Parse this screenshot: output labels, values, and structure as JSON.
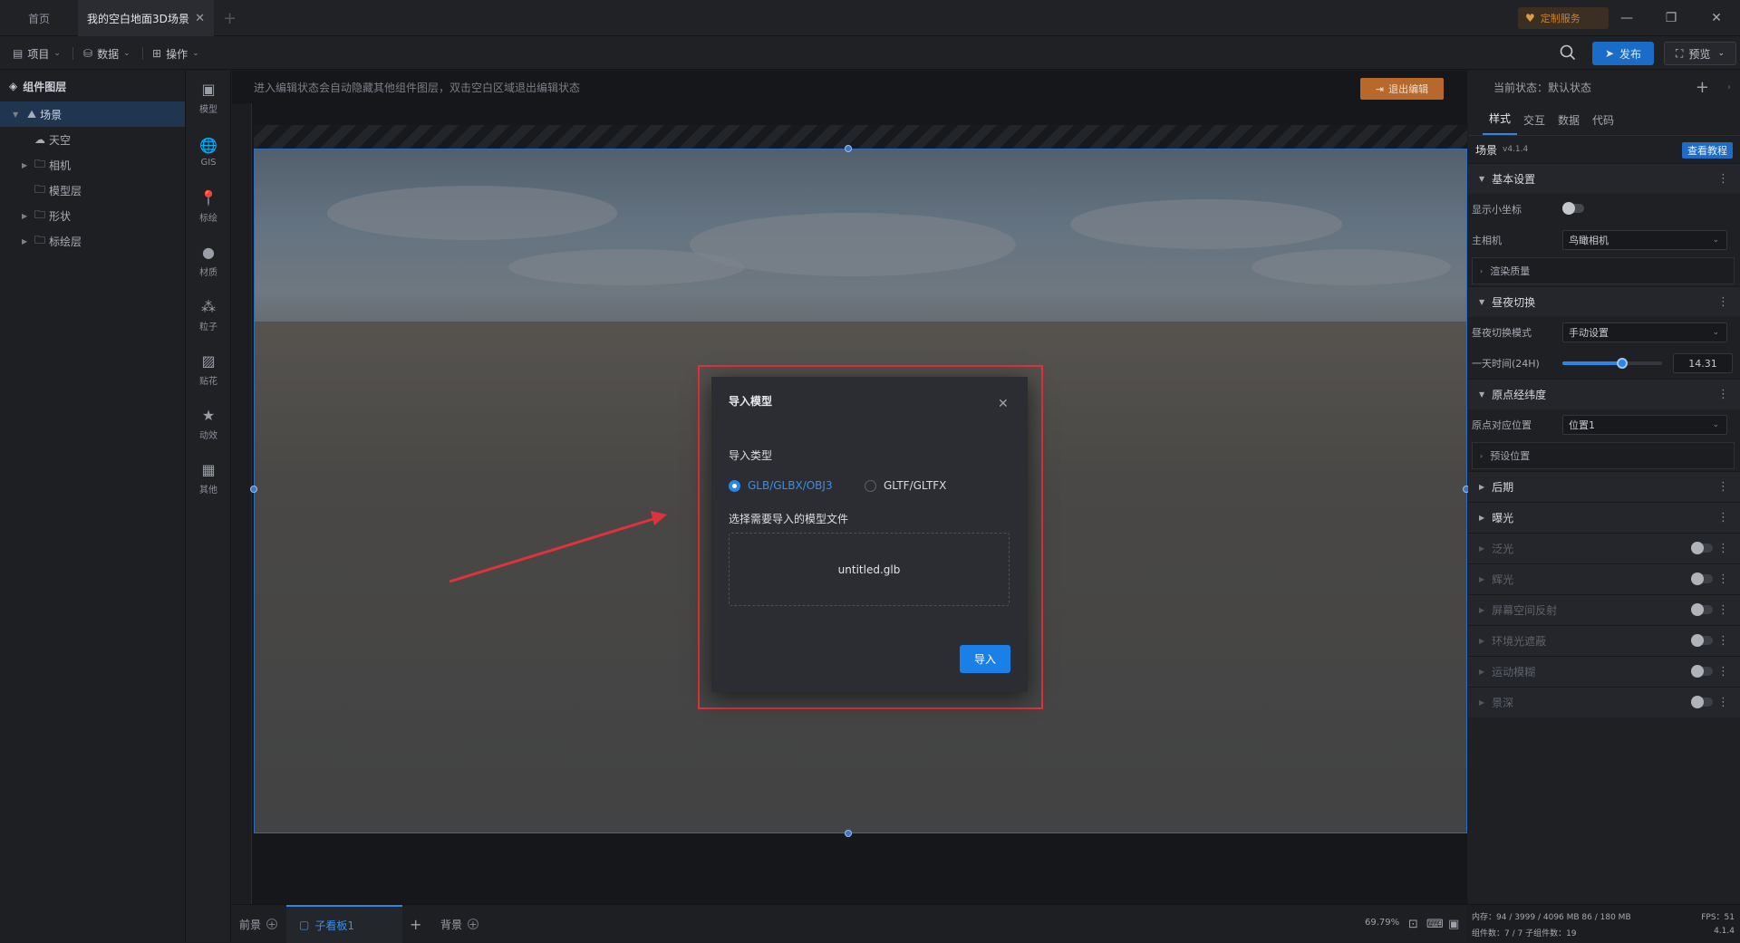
{
  "titlebar": {
    "tabs": [
      {
        "label": "首页"
      },
      {
        "label": "我的空白地面3D场景"
      }
    ],
    "custom_service": "定制服务"
  },
  "menubar": {
    "items": [
      {
        "label": "项目"
      },
      {
        "label": "数据"
      },
      {
        "label": "操作"
      }
    ],
    "publish": "发布",
    "preview": "预览"
  },
  "layers": {
    "title": "组件图层",
    "items": [
      {
        "label": "场景"
      },
      {
        "label": "天空"
      },
      {
        "label": "相机"
      },
      {
        "label": "模型层"
      },
      {
        "label": "形状"
      },
      {
        "label": "标绘层"
      }
    ]
  },
  "toolbar": {
    "items": [
      {
        "label": "模型",
        "icon": "cube-icon"
      },
      {
        "label": "GIS",
        "icon": "globe-icon"
      },
      {
        "label": "标绘",
        "icon": "pin-icon"
      },
      {
        "label": "材质",
        "icon": "sphere-icon"
      },
      {
        "label": "粒子",
        "icon": "particle-icon"
      },
      {
        "label": "贴花",
        "icon": "image-icon"
      },
      {
        "label": "动效",
        "icon": "star-icon"
      },
      {
        "label": "其他",
        "icon": "grid-icon"
      }
    ]
  },
  "canvas": {
    "hint": "进入编辑状态会自动隐藏其他组件图层，双击空白区域退出编辑状态",
    "exit_edit": "退出编辑"
  },
  "dialog": {
    "title": "导入模型",
    "import_type_label": "导入类型",
    "options": [
      {
        "label": "GLB/GLBX/OBJ3",
        "selected": true
      },
      {
        "label": "GLTF/GLTFX",
        "selected": false
      }
    ],
    "choose_label": "选择需要导入的模型文件",
    "file_name": "untitled.glb",
    "import_button": "导入"
  },
  "bottombar": {
    "foreground": "前景",
    "sub_canvas": "子看板1",
    "background": "背景",
    "zoom": "69.79%"
  },
  "rpanel": {
    "current_state": "当前状态：默认状态",
    "tabs": [
      {
        "label": "样式"
      },
      {
        "label": "交互"
      },
      {
        "label": "数据"
      },
      {
        "label": "代码"
      }
    ],
    "scene_title": "场景",
    "version": "v4.1.4",
    "tutorial": "查看教程",
    "basic_settings": "基本设置",
    "show_axis": "显示小坐标",
    "main_camera": "主相机",
    "main_camera_value": "鸟瞰相机",
    "render_quality": "渲染质量",
    "day_night": "昼夜切换",
    "day_night_mode": "昼夜切换模式",
    "day_night_mode_value": "手动设置",
    "day_time": "一天时间(24H)",
    "day_time_value": "14.31",
    "day_time_fraction": 0.6,
    "origin": "原点经纬度",
    "origin_pos": "原点对应位置",
    "origin_pos_value": "位置1",
    "preset_pos": "预设位置",
    "post": "后期",
    "exposure": "曝光",
    "bloom": "泛光",
    "glare": "辉光",
    "ssr": "屏幕空间反射",
    "ao": "环境光遮蔽",
    "motion_blur": "运动模糊",
    "dof": "景深"
  },
  "statusbar": {
    "memory": "内存：94 / 3999 / 4096 MB  86 / 180 MB",
    "fps": "FPS：51",
    "components": "组件数：7 / 7    子组件数：19",
    "version": "4.1.4"
  }
}
